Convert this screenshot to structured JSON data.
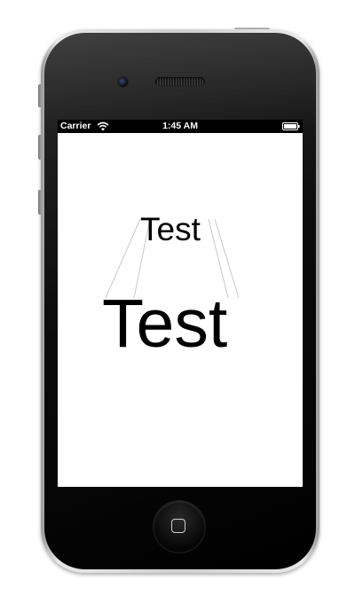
{
  "status_bar": {
    "carrier": "Carrier",
    "time": "1:45 AM",
    "wifi_icon": "wifi-icon",
    "battery_icon": "battery-icon"
  },
  "screen": {
    "small_label": "Test",
    "large_label": "Test",
    "guide_line_color": "#c8c8c8"
  },
  "device": {
    "camera_icon": "camera-icon",
    "speaker_icon": "speaker-grille-icon",
    "home_button_icon": "home-button-icon"
  }
}
